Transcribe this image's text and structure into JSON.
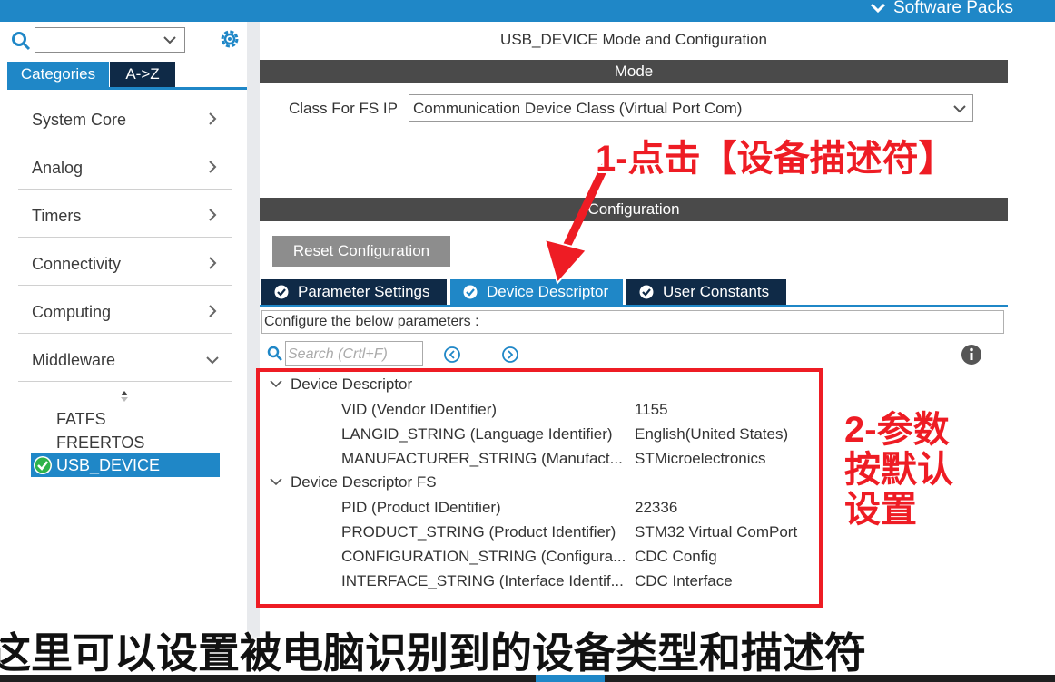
{
  "header": {
    "software_packs_label": "Software Packs"
  },
  "left_panel": {
    "tabs": [
      {
        "label": "Categories",
        "active": true
      },
      {
        "label": "A->Z",
        "active": false
      }
    ],
    "categories": [
      {
        "label": "System Core"
      },
      {
        "label": "Analog"
      },
      {
        "label": "Timers"
      },
      {
        "label": "Connectivity"
      },
      {
        "label": "Computing"
      },
      {
        "label": "Middleware"
      }
    ],
    "middleware_items": [
      {
        "label": "FATFS"
      },
      {
        "label": "FREERTOS"
      },
      {
        "label": "USB_DEVICE",
        "selected": true
      }
    ]
  },
  "main": {
    "title": "USB_DEVICE Mode and Configuration",
    "mode_header": "Mode",
    "class_label": "Class For FS IP",
    "class_value": "Communication Device Class (Virtual Port Com)",
    "config_header": "Configuration",
    "reset_button": "Reset Configuration",
    "config_tabs": [
      {
        "label": "Parameter Settings",
        "active": false
      },
      {
        "label": "Device Descriptor",
        "active": true
      },
      {
        "label": "User Constants",
        "active": false
      }
    ],
    "configure_text": "Configure the below parameters :",
    "search_placeholder": "Search (Crtl+F)",
    "tree": [
      {
        "group": "Device Descriptor",
        "params": [
          {
            "name": "VID (Vendor IDentifier)",
            "value": "1155"
          },
          {
            "name": "LANGID_STRING (Language Identifier)",
            "value": "English(United States)"
          },
          {
            "name": "MANUFACTURER_STRING (Manufact...",
            "value": "STMicroelectronics"
          }
        ]
      },
      {
        "group": "Device Descriptor FS",
        "params": [
          {
            "name": "PID (Product IDentifier)",
            "value": "22336"
          },
          {
            "name": "PRODUCT_STRING (Product Identifier)",
            "value": "STM32 Virtual ComPort"
          },
          {
            "name": "CONFIGURATION_STRING (Configura...",
            "value": "CDC Config"
          },
          {
            "name": "INTERFACE_STRING (Interface Identif...",
            "value": "CDC Interface"
          }
        ]
      }
    ]
  },
  "annotations": {
    "step1": "1-点击【设备描述符】",
    "step2_lines": [
      "2-参数",
      "按默认",
      "设置"
    ],
    "subtitle": "这里可以设置被电脑识别到的设备类型和描述符"
  },
  "colors": {
    "accent_blue": "#1f87c7",
    "dark_navy": "#0f2a47",
    "annotation_red": "#ee1c24",
    "section_gray": "#4a4a4a"
  }
}
